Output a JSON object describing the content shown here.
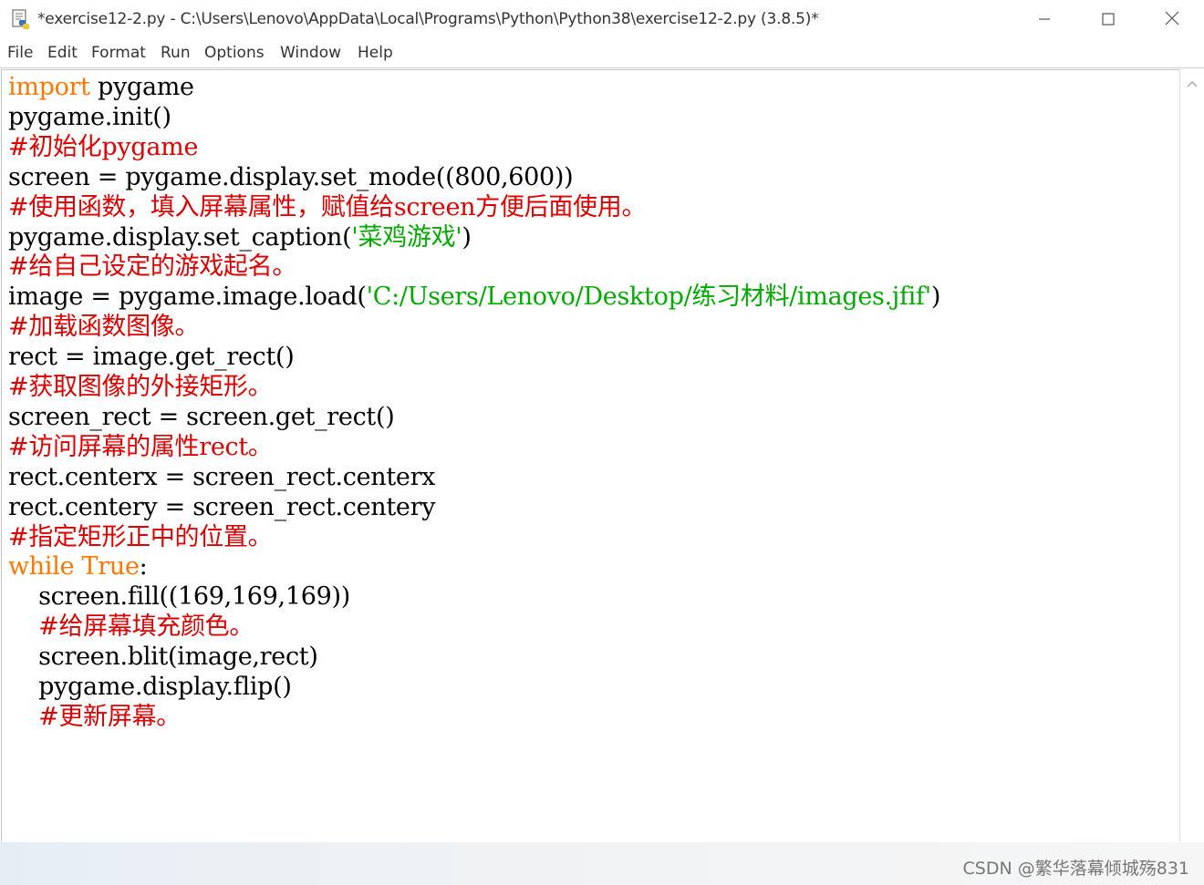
{
  "window": {
    "title": "*exercise12-2.py - C:\\Users\\Lenovo\\AppData\\Local\\Programs\\Python\\Python38\\exercise12-2.py (3.8.5)*",
    "icons": {
      "app": "python-file-icon",
      "minimize": "minimize-icon",
      "maximize": "maximize-icon",
      "close": "close-icon"
    }
  },
  "menu": [
    "File",
    "Edit",
    "Format",
    "Run",
    "Options",
    "Window",
    "Help"
  ],
  "code": [
    [
      {
        "t": "import",
        "c": "kw"
      },
      {
        "t": " pygame",
        "c": ""
      }
    ],
    [
      {
        "t": "pygame.init()",
        "c": ""
      }
    ],
    [
      {
        "t": "#初始化pygame",
        "c": "cm"
      }
    ],
    [
      {
        "t": "screen = pygame.display.set_mode((800,600))",
        "c": ""
      }
    ],
    [
      {
        "t": "#使用函数，填入屏幕属性，赋值给screen方便后面使用。",
        "c": "cm"
      }
    ],
    [
      {
        "t": "pygame.display.set_caption(",
        "c": ""
      },
      {
        "t": "'菜鸡游戏'",
        "c": "st"
      },
      {
        "t": ")",
        "c": ""
      }
    ],
    [
      {
        "t": "#给自己设定的游戏起名。",
        "c": "cm"
      }
    ],
    [
      {
        "t": "image = pygame.image.load(",
        "c": ""
      },
      {
        "t": "'C:/Users/Lenovo/Desktop/练习材料/images.jfif'",
        "c": "st"
      },
      {
        "t": ")",
        "c": ""
      }
    ],
    [
      {
        "t": "#加载函数图像。",
        "c": "cm"
      }
    ],
    [
      {
        "t": "rect = image.get_rect()",
        "c": ""
      }
    ],
    [
      {
        "t": "#获取图像的外接矩形。",
        "c": "cm"
      }
    ],
    [
      {
        "t": "screen_rect = screen.get_rect()",
        "c": ""
      }
    ],
    [
      {
        "t": "#访问屏幕的属性rect。",
        "c": "cm"
      }
    ],
    [
      {
        "t": "rect.centerx = screen_rect.centerx",
        "c": ""
      }
    ],
    [
      {
        "t": "rect.centery = screen_rect.centery",
        "c": ""
      }
    ],
    [
      {
        "t": "#指定矩形正中的位置。",
        "c": "cm"
      }
    ],
    [
      {
        "t": "while",
        "c": "kw"
      },
      {
        "t": " ",
        "c": ""
      },
      {
        "t": "True",
        "c": "kw"
      },
      {
        "t": ":",
        "c": ""
      }
    ],
    [
      {
        "t": "    screen.fill((169,169,169))",
        "c": ""
      }
    ],
    [
      {
        "t": "    ",
        "c": ""
      },
      {
        "t": "#给屏幕填充颜色。",
        "c": "cm"
      }
    ],
    [
      {
        "t": "    screen.blit(image,rect)",
        "c": ""
      }
    ],
    [
      {
        "t": "    pygame.display.flip()",
        "c": ""
      }
    ],
    [
      {
        "t": "    ",
        "c": ""
      },
      {
        "t": "#更新屏幕。",
        "c": "cm"
      }
    ]
  ],
  "scrollbar": {
    "arrow_icon": "scroll-up-arrow-icon"
  },
  "watermark": "CSDN @繁华落幕倾城殇831",
  "colors": {
    "keyword": "#ff7700",
    "comment": "#dd0000",
    "string": "#00aa00",
    "text": "#000000"
  }
}
